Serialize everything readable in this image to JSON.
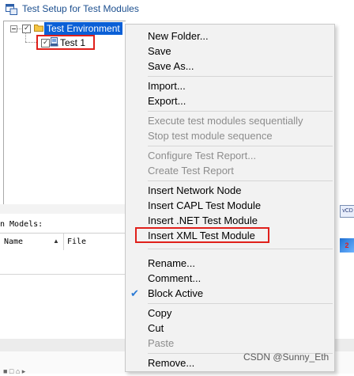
{
  "window": {
    "title": "Test Setup for Test Modules"
  },
  "tree": {
    "root_label": "Test Environment",
    "child_label": "Test 1"
  },
  "models": {
    "section_label": "n Models:",
    "columns": [
      "Name",
      "File"
    ]
  },
  "right_badges": {
    "vcd": "vCD",
    "blue": "2"
  },
  "context_menu": {
    "items": [
      {
        "label": "New Folder...",
        "enabled": true
      },
      {
        "label": "Save",
        "enabled": true
      },
      {
        "label": "Save As...",
        "enabled": true
      },
      {
        "label": "Import...",
        "enabled": true
      },
      {
        "label": "Export...",
        "enabled": true
      },
      {
        "label": "Execute test modules sequentially",
        "enabled": false
      },
      {
        "label": "Stop test module sequence",
        "enabled": false
      },
      {
        "label": "Configure Test Report...",
        "enabled": false
      },
      {
        "label": "Create Test Report",
        "enabled": false
      },
      {
        "label": "Insert Network Node",
        "enabled": true
      },
      {
        "label": "Insert CAPL Test Module",
        "enabled": true
      },
      {
        "label": "Insert .NET Test Module",
        "enabled": true
      },
      {
        "label": "Insert XML Test Module",
        "enabled": true
      },
      {
        "label": "Rename...",
        "enabled": true
      },
      {
        "label": "Comment...",
        "enabled": true
      },
      {
        "label": "Block Active",
        "enabled": true,
        "checked": true
      },
      {
        "label": "Copy",
        "enabled": true
      },
      {
        "label": "Cut",
        "enabled": true
      },
      {
        "label": "Paste",
        "enabled": false
      },
      {
        "label": "Remove...",
        "enabled": true
      }
    ]
  },
  "watermark": "CSDN @Sunny_Eth",
  "colors": {
    "selection": "#0a5fd6",
    "highlight_border": "#e0201b",
    "check_mark": "#2a7ad5",
    "title_text": "#1c4f8f"
  }
}
